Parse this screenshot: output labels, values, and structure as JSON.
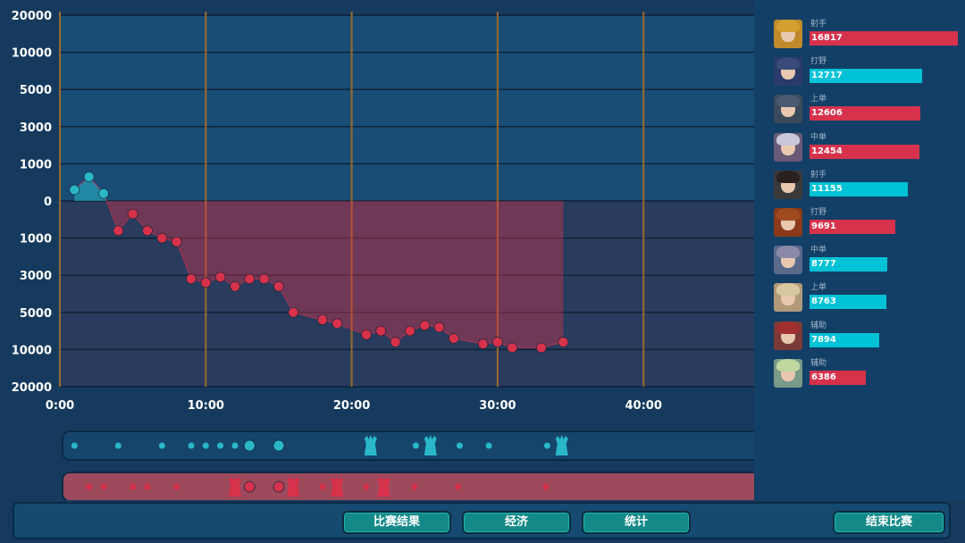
{
  "chart_data": {
    "type": "area",
    "y_tick_labels": [
      "20000",
      "10000",
      "5000",
      "3000",
      "1000",
      "0",
      "1000",
      "3000",
      "5000",
      "10000",
      "20000"
    ],
    "x_tick_labels": [
      "0:00",
      "10:00",
      "20:00",
      "30:00",
      "40:00"
    ],
    "x_minutes": [
      1,
      2,
      3,
      4,
      5,
      6,
      7,
      8,
      9,
      10,
      11,
      12,
      13,
      14,
      15,
      16,
      18,
      19,
      21,
      22,
      23,
      24,
      25,
      26,
      27,
      29,
      30,
      31,
      33,
      34.5
    ],
    "gold_difference_tick_index": [
      0.3,
      0.65,
      0.2,
      -0.8,
      -0.35,
      -0.8,
      -1.0,
      -1.1,
      -2.1,
      -2.2,
      -2.05,
      -2.3,
      -2.1,
      -2.1,
      -2.3,
      -3.0,
      -3.2,
      -3.3,
      -3.6,
      -3.5,
      -3.8,
      -3.5,
      -3.35,
      -3.4,
      -3.7,
      -3.85,
      -3.8,
      -3.95,
      -3.95,
      -3.8
    ],
    "grid": true,
    "series": [
      {
        "color": "#2ab8c8"
      },
      {
        "color": "#d6324c"
      }
    ]
  },
  "timelines": {
    "blue_events": [
      {
        "min": 1,
        "type": "kill-dot"
      },
      {
        "min": 4,
        "type": "kill-dot"
      },
      {
        "min": 7,
        "type": "kill-dot"
      },
      {
        "min": 9,
        "type": "kill-dot"
      },
      {
        "min": 10,
        "type": "kill-dot"
      },
      {
        "min": 11,
        "type": "kill-dot"
      },
      {
        "min": 12,
        "type": "kill-dot"
      },
      {
        "min": 13,
        "type": "objective-dot"
      },
      {
        "min": 15,
        "type": "objective-dot"
      },
      {
        "min": 21.3,
        "type": "tower-icon"
      },
      {
        "min": 24.4,
        "type": "kill-dot"
      },
      {
        "min": 25.4,
        "type": "tower-icon"
      },
      {
        "min": 27.4,
        "type": "kill-dot"
      },
      {
        "min": 29.4,
        "type": "kill-dot"
      },
      {
        "min": 33.4,
        "type": "kill-dot"
      },
      {
        "min": 34.4,
        "type": "tower-icon"
      }
    ],
    "red_events": [
      {
        "min": 2,
        "type": "kill-dot"
      },
      {
        "min": 3,
        "type": "kill-dot"
      },
      {
        "min": 5,
        "type": "kill-dot"
      },
      {
        "min": 6,
        "type": "kill-dot"
      },
      {
        "min": 8,
        "type": "kill-dot"
      },
      {
        "min": 12,
        "type": "tower-icon"
      },
      {
        "min": 13,
        "type": "objective-dot"
      },
      {
        "min": 15,
        "type": "objective-dot"
      },
      {
        "min": 16,
        "type": "tower-icon"
      },
      {
        "min": 18,
        "type": "kill-dot"
      },
      {
        "min": 19,
        "type": "tower-icon"
      },
      {
        "min": 21,
        "type": "kill-dot"
      },
      {
        "min": 22.2,
        "type": "tower-icon"
      },
      {
        "min": 24.3,
        "type": "kill-dot"
      },
      {
        "min": 27.3,
        "type": "kill-dot"
      },
      {
        "min": 33.3,
        "type": "kill-dot"
      }
    ],
    "blue_color": "#2ab8c8",
    "red_color": "#d6324c"
  },
  "players": [
    {
      "role": "射手",
      "value": "16817",
      "value_num": 16817,
      "team": "red",
      "avatar": "hero-portrait-gold"
    },
    {
      "role": "打野",
      "value": "12717",
      "value_num": 12717,
      "team": "blue",
      "avatar": "hero-portrait-blue-armor"
    },
    {
      "role": "上单",
      "value": "12606",
      "value_num": 12606,
      "team": "red",
      "avatar": "hero-portrait-mech"
    },
    {
      "role": "中单",
      "value": "12454",
      "value_num": 12454,
      "team": "red",
      "avatar": "hero-portrait-white-hair"
    },
    {
      "role": "射手",
      "value": "11155",
      "value_num": 11155,
      "team": "blue",
      "avatar": "hero-portrait-dark-hair"
    },
    {
      "role": "打野",
      "value": "9691",
      "value_num": 9691,
      "team": "red",
      "avatar": "hero-portrait-monkey"
    },
    {
      "role": "中单",
      "value": "8777",
      "value_num": 8777,
      "team": "blue",
      "avatar": "hero-portrait-fox"
    },
    {
      "role": "上单",
      "value": "8763",
      "value_num": 8763,
      "team": "blue",
      "avatar": "hero-portrait-old-warrior"
    },
    {
      "role": "辅助",
      "value": "7894",
      "value_num": 7894,
      "team": "blue",
      "avatar": "hero-portrait-red-hair"
    },
    {
      "role": "辅助",
      "value": "6386",
      "value_num": 6386,
      "team": "red",
      "avatar": "hero-portrait-green-crown"
    }
  ],
  "colors": {
    "blue_bar": "#00c2d6",
    "red_bar": "#d6324c"
  },
  "buttons": {
    "match_result": "比赛结果",
    "economy": "经济",
    "stats": "统计",
    "end_match": "结束比赛"
  }
}
